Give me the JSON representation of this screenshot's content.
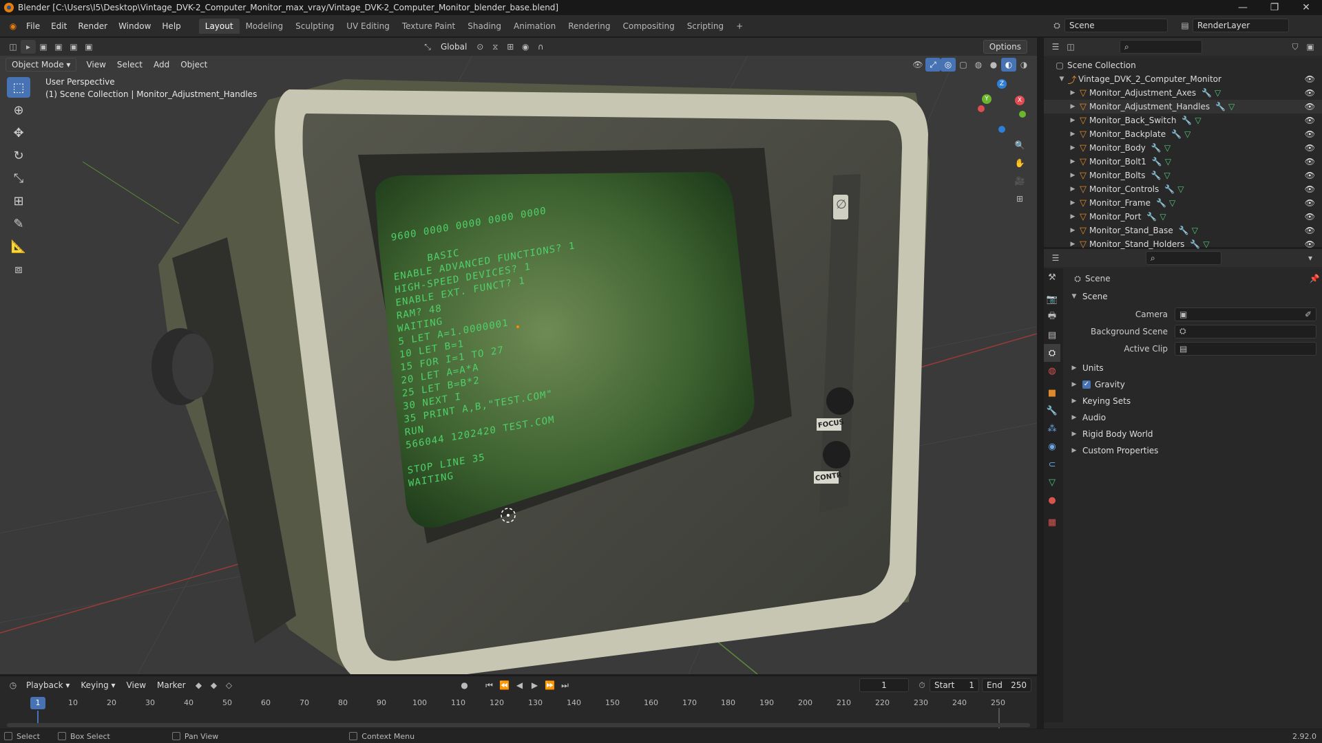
{
  "window": {
    "title": "Blender [C:\\Users\\I5\\Desktop\\Vintage_DVK-2_Computer_Monitor_max_vray/Vintage_DVK-2_Computer_Monitor_blender_base.blend]",
    "min": "—",
    "max": "❐",
    "close": "✕"
  },
  "menu": [
    "File",
    "Edit",
    "Render",
    "Window",
    "Help"
  ],
  "workspaces": [
    "Layout",
    "Modeling",
    "Sculpting",
    "UV Editing",
    "Texture Paint",
    "Shading",
    "Animation",
    "Rendering",
    "Compositing",
    "Scripting"
  ],
  "workspace_add": "+",
  "scene": {
    "name": "Scene",
    "render_layer": "RenderLayer"
  },
  "tool_header": {
    "orientation": "Global",
    "options": "Options"
  },
  "viewport": {
    "mode": "Object Mode",
    "menus": [
      "View",
      "Select",
      "Add",
      "Object"
    ],
    "info_line1": "User Perspective",
    "info_line2": "(1) Scene Collection | Monitor_Adjustment_Handles",
    "gizmo": {
      "x": "X",
      "y": "Y",
      "z": "Z"
    },
    "screen_text": [
      "9600 0000 0000 0000 0000",
      "BASIC",
      "ENABLE ADVANCED FUNCTIONS? 1",
      "HIGH-SPEED DEVICES? 1",
      "ENABLE EXT. FUNCT? 1",
      "RAM? 48",
      "WAITING",
      "5 LET A=1.0000001",
      "10 LET B=1",
      "15 FOR I=1 TO 27",
      "20 LET A=A*A",
      "25 LET B=B*2",
      "30 NEXT I",
      "35 PRINT A,B,\"TEST.COM\"",
      "RUN",
      "566044 1202420 TEST.COM",
      "STOP LINE 35",
      "WAITING"
    ],
    "knob_labels": [
      "FOCUS",
      "CONTR"
    ],
    "panel_symbol": "∅"
  },
  "outliner": {
    "root": "Scene Collection",
    "collection": "Vintage_DVK_2_Computer_Monitor",
    "objects": [
      "Monitor_Adjustment_Axes",
      "Monitor_Adjustment_Handles",
      "Monitor_Back_Switch",
      "Monitor_Backplate",
      "Monitor_Body",
      "Monitor_Bolt1",
      "Monitor_Bolts",
      "Monitor_Controls",
      "Monitor_Frame",
      "Monitor_Port",
      "Monitor_Stand_Base",
      "Monitor_Stand_Holders"
    ],
    "selected": "Monitor_Adjustment_Handles"
  },
  "properties": {
    "context": "Scene",
    "section": "Scene",
    "fields": [
      {
        "label": "Camera"
      },
      {
        "label": "Background Scene"
      },
      {
        "label": "Active Clip"
      }
    ],
    "panels": [
      "Units",
      "Gravity",
      "Keying Sets",
      "Audio",
      "Rigid Body World",
      "Custom Properties"
    ],
    "gravity_checked": true
  },
  "timeline": {
    "menus": [
      "Playback",
      "Keying",
      "View",
      "Marker"
    ],
    "current_frame": "1",
    "start_label": "Start",
    "start": "1",
    "end_label": "End",
    "end": "250",
    "ticks": [
      "1",
      "10",
      "20",
      "30",
      "40",
      "50",
      "60",
      "70",
      "80",
      "90",
      "100",
      "110",
      "120",
      "130",
      "140",
      "150",
      "160",
      "170",
      "180",
      "190",
      "200",
      "210",
      "220",
      "230",
      "240",
      "250"
    ]
  },
  "statusbar": {
    "select": "Select",
    "box_select": "Box Select",
    "pan_view": "Pan View",
    "context_menu": "Context Menu",
    "version": "2.92.0"
  },
  "colors": {
    "accent": "#4772b3",
    "mesh": "#e0892a",
    "modifier": "#6aa8e8",
    "meshdata": "#4fc97e",
    "screen_text": "#4fd06a",
    "frame_marker": "#4772b3"
  }
}
